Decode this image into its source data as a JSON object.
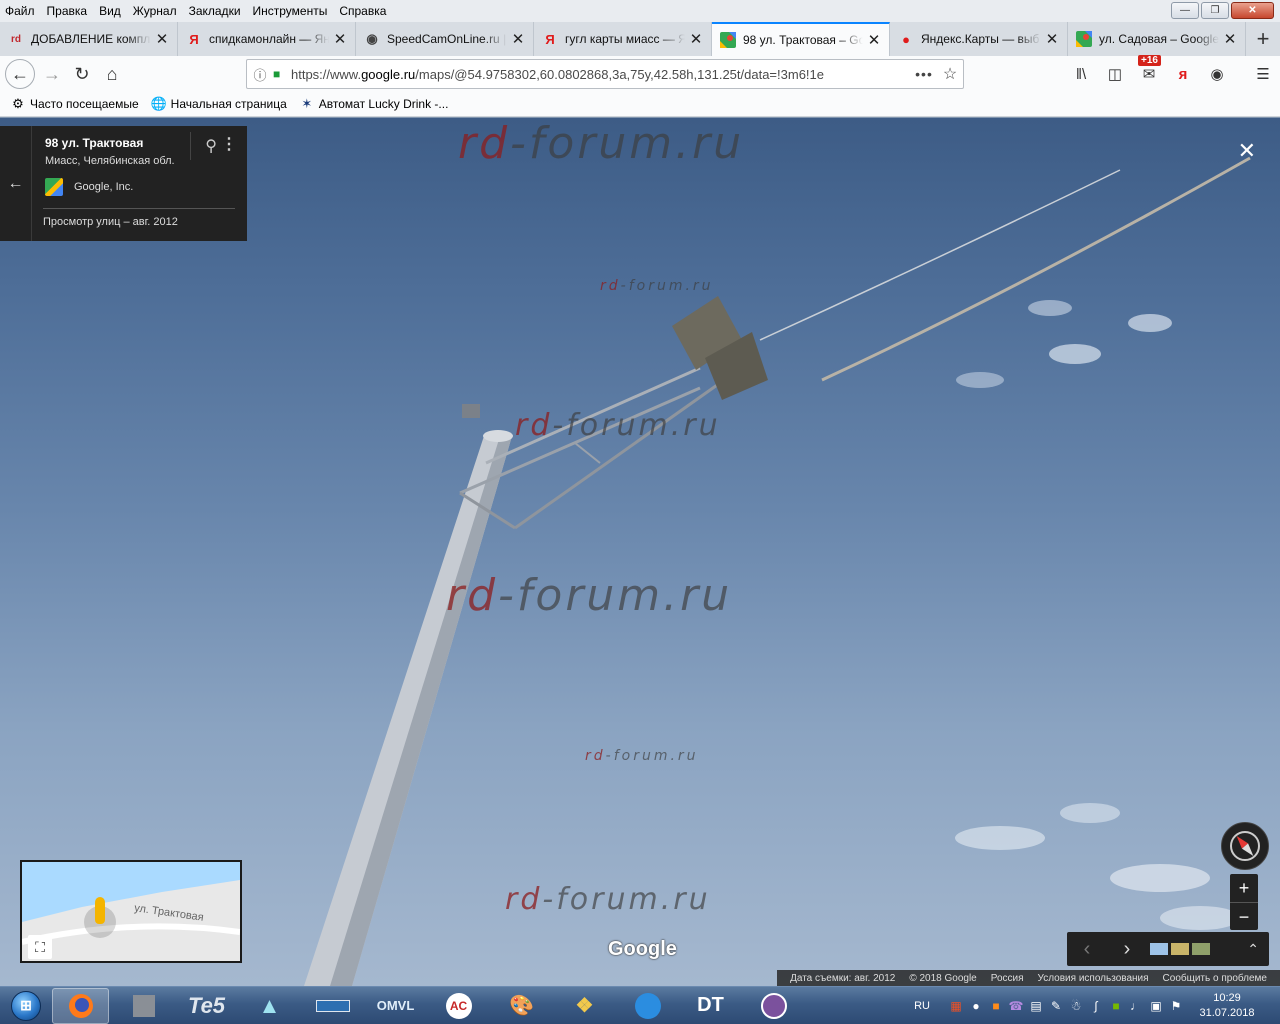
{
  "menu": {
    "items": [
      "Файл",
      "Правка",
      "Вид",
      "Журнал",
      "Закладки",
      "Инструменты",
      "Справка"
    ]
  },
  "tabs": [
    {
      "label": "ДОБАВЛЕНИЕ компл",
      "icon": "rd-icon",
      "active": false
    },
    {
      "label": "спидкамонлайн — Ян",
      "icon": "yandex-icon",
      "active": false
    },
    {
      "label": "SpeedCamOnLine.ru |",
      "icon": "speedcam-icon",
      "active": false
    },
    {
      "label": "гугл карты миасс — Я",
      "icon": "yandex-icon",
      "active": false
    },
    {
      "label": "98 ул. Трактовая – Go",
      "icon": "google-maps-icon",
      "active": true
    },
    {
      "label": "Яндекс.Карты — выб",
      "icon": "yandex-maps-icon",
      "active": false
    },
    {
      "label": "ул. Садовая – Google",
      "icon": "google-maps-icon",
      "active": false
    }
  ],
  "navbar": {
    "url_prefix": "https://www.",
    "url_host": "google.ru",
    "url_rest": "/maps/@54.9758302,60.0802868,3a,75y,42.58h,131.25t/data=!3m6!1e",
    "badge": "+16",
    "yandex_letter": "я"
  },
  "bookmarks": [
    {
      "label": "Часто посещаемые",
      "icon": "gear-icon"
    },
    {
      "label": "Начальная страница",
      "icon": "globe-icon"
    },
    {
      "label": "Автомат Lucky Drink -...",
      "icon": "star-icon"
    }
  ],
  "streetview": {
    "address": "98 ул. Трактовая",
    "city": "Миасс, Челябинская обл.",
    "provider": "Google, Inc.",
    "date": "Просмотр улиц – авг. 2012",
    "minimap_road": "ул. Трактовая",
    "logo": "Google",
    "watermark": "rd-forum.ru"
  },
  "footer": {
    "items": [
      "Дата съемки: авг. 2012",
      "© 2018 Google",
      "Россия",
      "Условия использования",
      "Сообщить о проблеме"
    ]
  },
  "taskbar": {
    "apps": [
      {
        "label": "",
        "icon": "firefox-icon",
        "active": true
      },
      {
        "label": "",
        "icon": "archive-icon",
        "active": false
      },
      {
        "label": "Te5",
        "icon": "te5-icon",
        "active": false
      },
      {
        "label": "",
        "icon": "app-icon",
        "active": false
      },
      {
        "label": "",
        "icon": "app-icon",
        "active": false
      },
      {
        "label": "OMVL",
        "icon": "omvl-icon",
        "active": false
      },
      {
        "label": "AC",
        "icon": "ac-icon",
        "active": false
      },
      {
        "label": "",
        "icon": "paint-icon",
        "active": false
      },
      {
        "label": "",
        "icon": "app-icon",
        "active": false
      },
      {
        "label": "",
        "icon": "app-icon",
        "active": false
      },
      {
        "label": "DT",
        "icon": "dt-icon",
        "active": false
      },
      {
        "label": "",
        "icon": "viber-icon",
        "active": false
      }
    ],
    "lang": "RU",
    "time": "10:29",
    "date": "31.07.2018"
  }
}
